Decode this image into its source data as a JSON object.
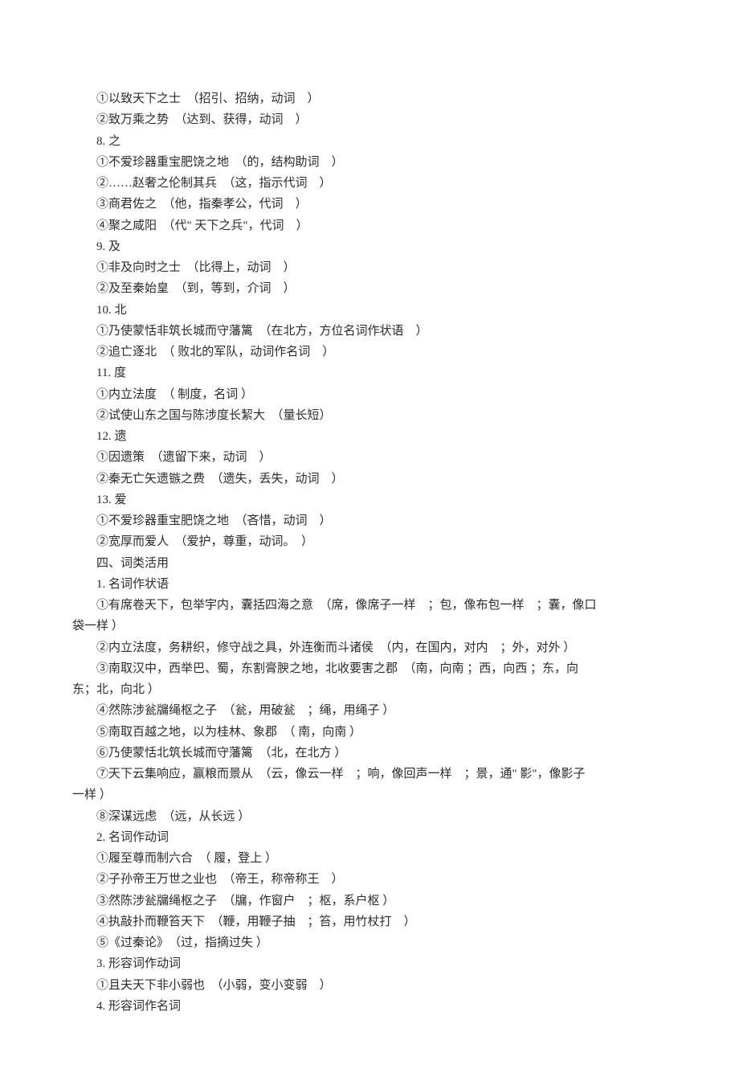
{
  "lines": [
    {
      "text": "①以致天下之士　（招引、招纳，动词　）",
      "indent": true
    },
    {
      "text": "②致万乘之势　（达到、获得，动词　）",
      "indent": true
    },
    {
      "text": "8. 之",
      "indent": true
    },
    {
      "text": "①不爱珍器重宝肥饶之地　（的，结构助词　）",
      "indent": true
    },
    {
      "text": "②……赵奢之伦制其兵　（这，指示代词　）",
      "indent": true
    },
    {
      "text": "③商君佐之　（他，指秦孝公，代词　）",
      "indent": true
    },
    {
      "text": "④聚之咸阳　（代\" 天下之兵\"，代词　）",
      "indent": true
    },
    {
      "text": "9. 及",
      "indent": true
    },
    {
      "text": "①非及向时之士　（比得上，动词　）",
      "indent": true
    },
    {
      "text": "②及至秦始皇　（到，等到，介词　）",
      "indent": true
    },
    {
      "text": "10. 北",
      "indent": true
    },
    {
      "text": "①乃使蒙恬非筑长城而守藩篱　（在北方，方位名词作状语　）",
      "indent": true
    },
    {
      "text": "②追亡逐北　（ 败北的军队，动词作名词　）",
      "indent": true
    },
    {
      "text": "11. 度",
      "indent": true
    },
    {
      "text": "①内立法度　（ 制度，名词 ）",
      "indent": true
    },
    {
      "text": "②试使山东之国与陈涉度长絜大　（量长短）",
      "indent": true
    },
    {
      "text": "12. 遗",
      "indent": true
    },
    {
      "text": "①因遗策　（遗留下来，动词　）",
      "indent": true
    },
    {
      "text": "②秦无亡矢遗镞之费　（遗失，丢失，动词　）",
      "indent": true
    },
    {
      "text": "13. 爱",
      "indent": true
    },
    {
      "text": "①不爱珍器重宝肥饶之地　（吝惜，动词　）",
      "indent": true
    },
    {
      "text": "②宽厚而爱人　（爱护，尊重，动词。　）",
      "indent": true
    },
    {
      "text": "四、词类活用",
      "indent": true
    },
    {
      "text": "1. 名词作状语",
      "indent": true
    },
    {
      "text": "①有席卷天下，包举宇内，囊括四海之意　（席，像席子一样　；包，像布包一样　；囊，像口",
      "indent": true
    },
    {
      "text": "袋一样 ）",
      "indent": false
    },
    {
      "text": "②内立法度，务耕织，修守战之具，外连衡而斗诸侯　（内，在国内，对内　；外，对外 ）",
      "indent": true
    },
    {
      "text": "③南取汉中，西举巴、蜀，东割膏腴之地，北收要害之郡　（南，向南 ；西，向西 ；东，向",
      "indent": true
    },
    {
      "text": "东；北，向北 ）",
      "indent": false
    },
    {
      "text": "④然陈涉瓮牖绳枢之子　（瓮，用破瓮　；绳，用绳子 ）",
      "indent": true
    },
    {
      "text": "⑤南取百越之地，以为桂林、象郡　（ 南，向南 ）",
      "indent": true
    },
    {
      "text": "⑥乃使蒙恬北筑长城而守藩篱　（北，在北方 ）",
      "indent": true
    },
    {
      "text": "⑦天下云集响应，赢粮而景从　（云，像云一样　；响，像回声一样　；景，通\" 影\"，像影子",
      "indent": true
    },
    {
      "text": "一样 ）",
      "indent": false
    },
    {
      "text": "⑧深谋远虑　（远，从长远 ）",
      "indent": true
    },
    {
      "text": "2. 名词作动词",
      "indent": true
    },
    {
      "text": "①履至尊而制六合　（ 履，登上 ）",
      "indent": true
    },
    {
      "text": "②子孙帝王万世之业也　（帝王，称帝称王　）",
      "indent": true
    },
    {
      "text": "③然陈涉瓮牖绳枢之子　（牖，作窗户　；枢，系户枢 ）",
      "indent": true
    },
    {
      "text": "④执敲扑而鞭笞天下　（鞭，用鞭子抽　；笞，用竹杖打　）",
      "indent": true
    },
    {
      "text": "⑤《过秦论》　（过，指摘过失  ）",
      "indent": true
    },
    {
      "text": "3. 形容词作动词",
      "indent": true
    },
    {
      "text": "①且夫天下非小弱也　（小弱，变小变弱　）",
      "indent": true
    },
    {
      "text": "4. 形容词作名词",
      "indent": true
    }
  ]
}
